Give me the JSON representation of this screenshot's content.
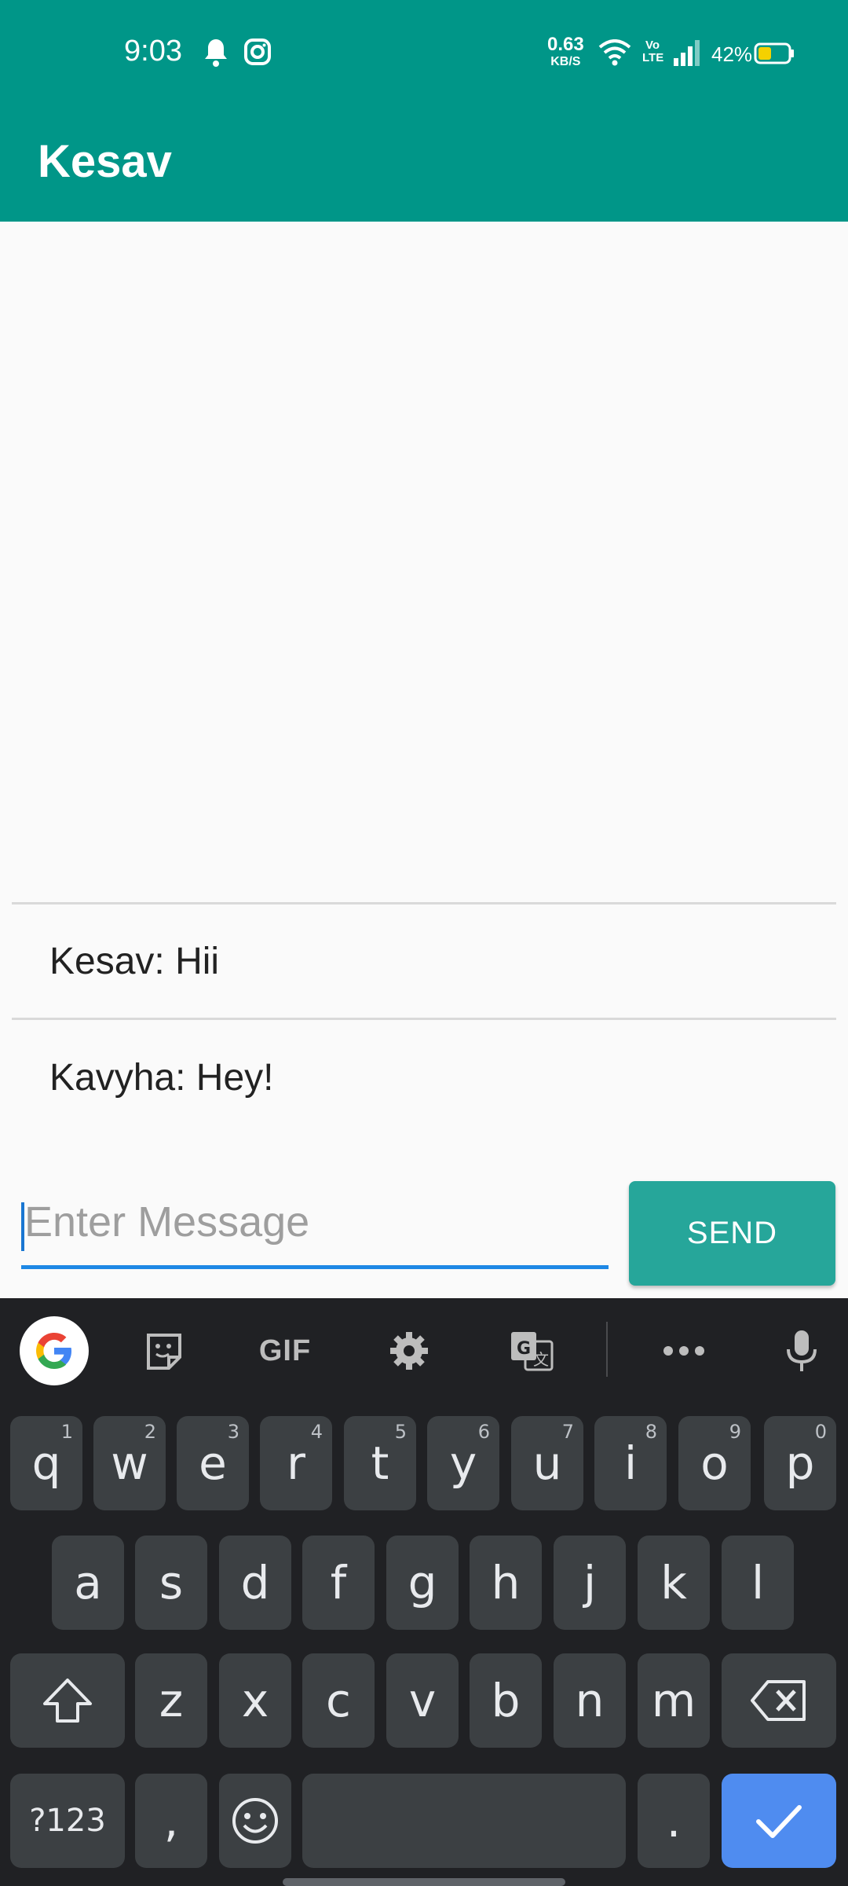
{
  "status_bar": {
    "time": "9:03",
    "net_speed_value": "0.63",
    "net_speed_unit": "KB/S",
    "volte_label": "Vo LTE",
    "battery": "42%",
    "icons": [
      "bell-icon",
      "instagram-icon",
      "wifi-icon",
      "volte-icon",
      "signal-icon",
      "battery-icon"
    ]
  },
  "app_bar": {
    "title": "Kesav"
  },
  "messages": [
    {
      "text": "Kesav: Hii"
    },
    {
      "text": "Kavyha: Hey!"
    }
  ],
  "composer": {
    "placeholder": "Enter Message",
    "value": "",
    "send_label": "SEND"
  },
  "keyboard": {
    "toolbar": [
      "google-icon",
      "sticker-icon",
      "GIF",
      "gear-icon",
      "translate-icon",
      "more-icon",
      "mic-icon"
    ],
    "gif_label": "GIF",
    "row1": [
      {
        "k": "q",
        "h": "1"
      },
      {
        "k": "w",
        "h": "2"
      },
      {
        "k": "e",
        "h": "3"
      },
      {
        "k": "r",
        "h": "4"
      },
      {
        "k": "t",
        "h": "5"
      },
      {
        "k": "y",
        "h": "6"
      },
      {
        "k": "u",
        "h": "7"
      },
      {
        "k": "i",
        "h": "8"
      },
      {
        "k": "o",
        "h": "9"
      },
      {
        "k": "p",
        "h": "0"
      }
    ],
    "row2": [
      "a",
      "s",
      "d",
      "f",
      "g",
      "h",
      "j",
      "k",
      "l"
    ],
    "row3": [
      "z",
      "x",
      "c",
      "v",
      "b",
      "n",
      "m"
    ],
    "symbols_label": "?123",
    "comma": ",",
    "period": "."
  },
  "colors": {
    "primary": "#009688",
    "accent": "#26a69a",
    "keyboard_bg": "#202124",
    "key_bg": "#3c4043",
    "done_key": "#4f8cf0"
  }
}
